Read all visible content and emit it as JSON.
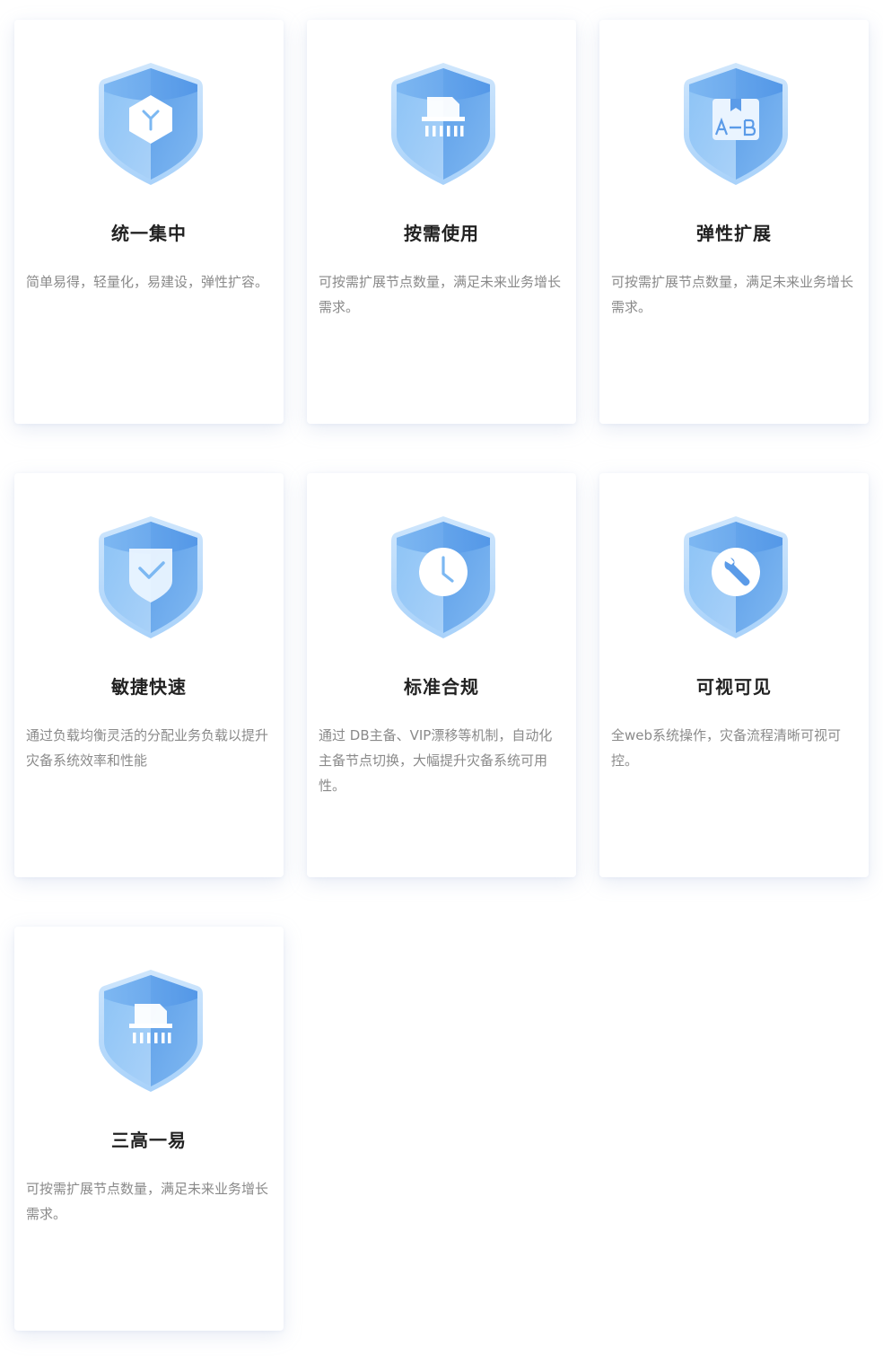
{
  "colors": {
    "shield_light": "#b8dcfb",
    "shield_mid": "#7cb8f2",
    "shield_dark": "#4e97e8",
    "card_bg": "#ffffff",
    "title": "#222222",
    "desc": "#8a8a8a"
  },
  "cards": [
    {
      "icon": "cube-icon",
      "title": "统一集中",
      "desc": "简单易得，轻量化，易建设，弹性扩容。"
    },
    {
      "icon": "shredder-icon",
      "title": "按需使用",
      "desc": "可按需扩展节点数量，满足未来业务增长需求。"
    },
    {
      "icon": "ab-switch-icon",
      "title": "弹性扩展",
      "desc": "可按需扩展节点数量，满足未来业务增长需求。"
    },
    {
      "icon": "check-shield-icon",
      "title": "敏捷快速",
      "desc": "通过负载均衡灵活的分配业务负载以提升灾备系统效率和性能"
    },
    {
      "icon": "clock-icon",
      "title": "标准合规",
      "desc": "通过 DB主备、VIP漂移等机制，自动化主备节点切换，大幅提升灾备系统可用性。"
    },
    {
      "icon": "wrench-icon",
      "title": "可视可见",
      "desc": "全web系统操作，灾备流程清晰可视可控。"
    },
    {
      "icon": "shredder-icon",
      "title": "三高一易",
      "desc": "可按需扩展节点数量，满足未来业务增长需求。"
    }
  ]
}
